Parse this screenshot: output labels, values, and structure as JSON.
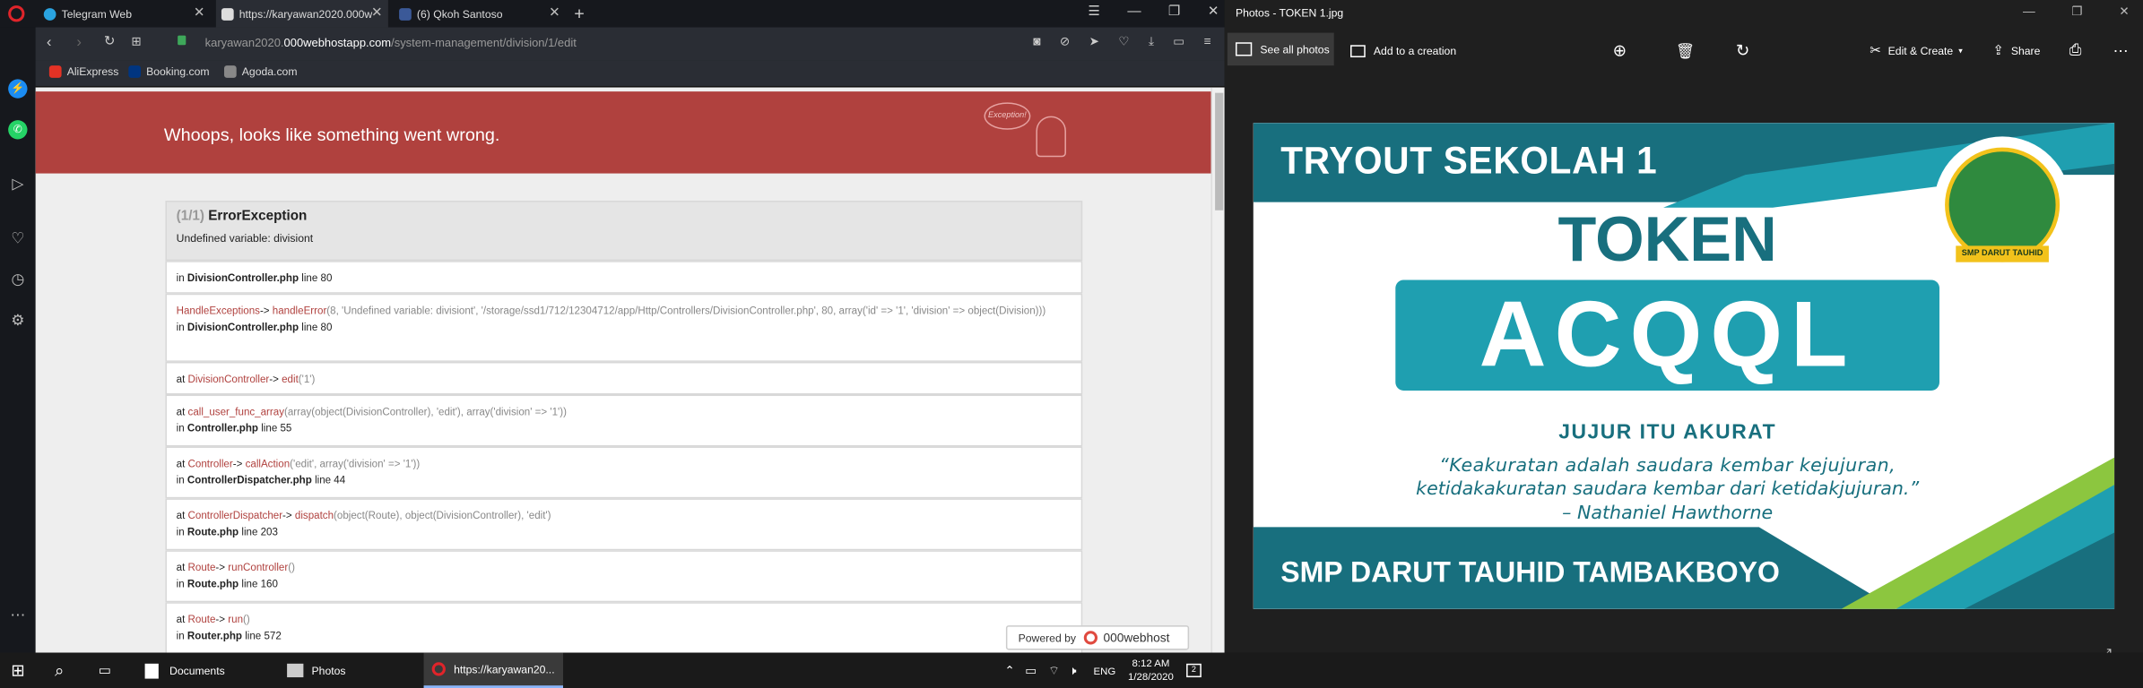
{
  "browser": {
    "tabs": [
      {
        "label": "Telegram Web"
      },
      {
        "label": "https://karyawan2020.000w"
      },
      {
        "label": "(6) Qkoh Santoso"
      }
    ],
    "new_tab": "+",
    "url_prefix": "karyawan2020.",
    "url_host": "000webhostapp.com",
    "url_path": "/system-management/division/1/edit",
    "bookmarks": [
      {
        "label": "AliExpress",
        "color": "#e43225"
      },
      {
        "label": "Booking.com",
        "color": "#003580"
      },
      {
        "label": "Agoda.com",
        "color": "#777777"
      }
    ]
  },
  "error": {
    "title": "Whoops, looks like something went wrong.",
    "badge": "Exception!",
    "count": "(1/1)",
    "type": "ErrorException",
    "message": "Undefined variable: divisiont",
    "frames": [
      {
        "in": "in",
        "file": "DivisionController.php",
        "line": "line 80"
      },
      {
        "cls": "HandleExceptions",
        "op": "->",
        "fn": "handleError",
        "args": "(8, 'Undefined variable: divisiont', '/storage/ssd1/712/12304712/app/Http/Controllers/DivisionController.php', 80, array('id' => '1', 'division' => object(Division)))",
        "in": "in",
        "file": "DivisionController.php",
        "line": "line 80"
      },
      {
        "at": "at",
        "cls": "DivisionController",
        "op": "->",
        "fn": "edit",
        "args": "('1')"
      },
      {
        "at": "at",
        "fn": "call_user_func_array",
        "args": "(array(object(DivisionController), 'edit'), array('division' => '1'))",
        "in": "in",
        "file": "Controller.php",
        "line": "line 55"
      },
      {
        "at": "at",
        "cls": "Controller",
        "op": "->",
        "fn": "callAction",
        "args": "('edit', array('division' => '1'))",
        "in": "in",
        "file": "ControllerDispatcher.php",
        "line": "line 44"
      },
      {
        "at": "at",
        "cls": "ControllerDispatcher",
        "op": "->",
        "fn": "dispatch",
        "args": "(object(Route), object(DivisionController), 'edit')",
        "in": "in",
        "file": "Route.php",
        "line": "line 203"
      },
      {
        "at": "at",
        "cls": "Route",
        "op": "->",
        "fn": "runController",
        "args": "()",
        "in": "in",
        "file": "Route.php",
        "line": "line 160"
      },
      {
        "at": "at",
        "cls": "Route",
        "op": "->",
        "fn": "run",
        "args": "()",
        "in": "in",
        "file": "Router.php",
        "line": "line 572"
      }
    ],
    "powered_by": "Powered by",
    "powered_brand": "000webhost"
  },
  "photos": {
    "title": "Photos - TOKEN 1.jpg",
    "see_all": "See all photos",
    "add_creation": "Add to a creation",
    "edit_create": "Edit & Create",
    "share": "Share"
  },
  "token_image": {
    "heading": "TRYOUT SEKOLAH 1",
    "token_label": "TOKEN",
    "token_code": "ACQQL",
    "motto": "JUJUR ITU AKURAT",
    "quote1": "“Keakuratan adalah saudara kembar kejujuran,",
    "quote2": "ketidakakuratan saudara kembar dari ketidakjujuran.”",
    "quote3": "– Nathaniel Hawthorne",
    "school": "SMP DARUT TAUHID TAMBAKBOYO",
    "logo_text": "SMP DARUT TAUHID"
  },
  "taskbar": {
    "apps": [
      {
        "label": "Documents"
      },
      {
        "label": "Photos"
      },
      {
        "label": "https://karyawan20..."
      }
    ],
    "lang": "ENG",
    "time": "8:12 AM",
    "date": "1/28/2020",
    "notif": "2"
  },
  "colors": {
    "error_red": "#b0413e",
    "teal": "#1f9fb0",
    "dark_teal": "#186f7e"
  }
}
